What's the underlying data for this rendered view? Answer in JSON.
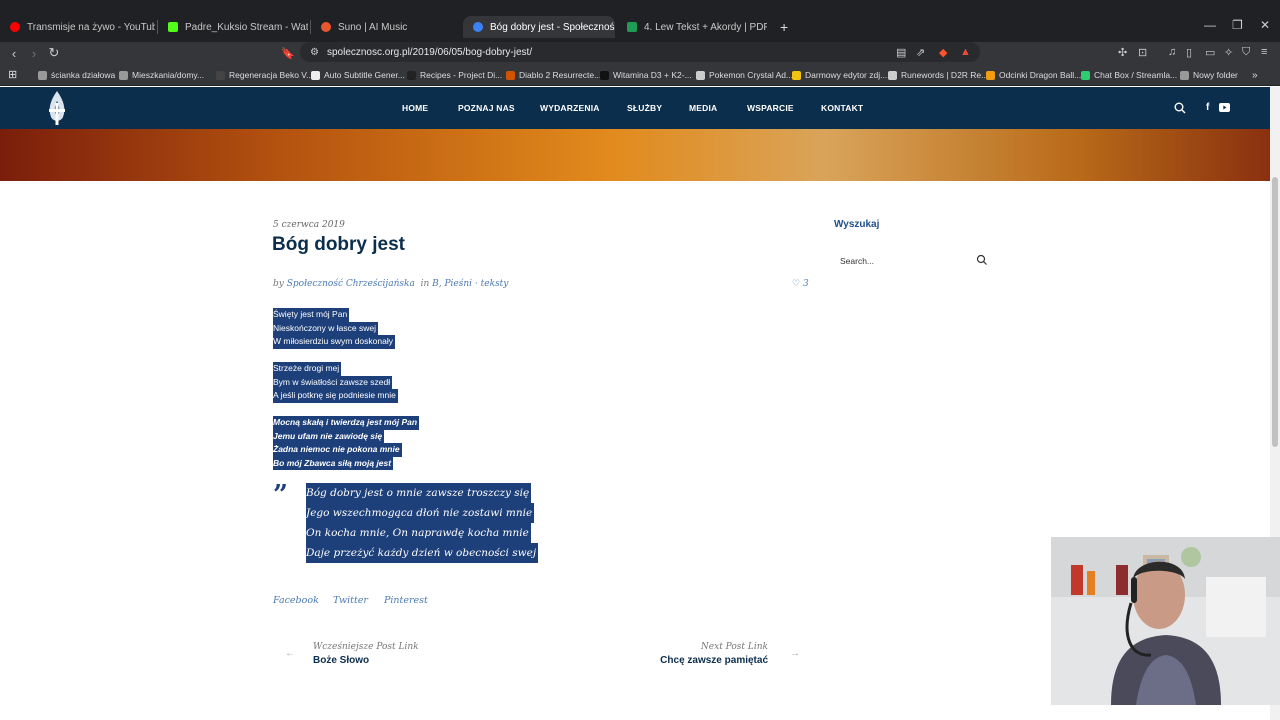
{
  "browser": {
    "tabs": [
      {
        "label": "Transmisje na żywo - YouTube Studio",
        "color": "#ff0000"
      },
      {
        "label": "Padre_Kuksio Stream - Watch Live on",
        "color": "#53fc18"
      },
      {
        "label": "Suno | AI Music",
        "color": "#e8572f"
      },
      {
        "label": "Bóg dobry jest - Społeczność Ch",
        "color": "#3b82f6",
        "active": true
      },
      {
        "label": "4. Lew Tekst + Akordy | PDF",
        "color": "#1f9d55"
      }
    ],
    "new_tab": "+",
    "url": "spolecznosc.org.pl/2019/06/05/bog-dobry-jest/",
    "bookmarks": [
      {
        "label": "ścianka działowa",
        "color": "#999"
      },
      {
        "label": "Mieszkania/domy...",
        "color": "#999"
      },
      {
        "label": "Regeneracja Beko V...",
        "color": "#444"
      },
      {
        "label": "Auto Subtitle Gener...",
        "color": "#eee"
      },
      {
        "label": "Recipes - Project Di...",
        "color": "#222"
      },
      {
        "label": "Diablo 2 Resurrecte...",
        "color": "#d35400"
      },
      {
        "label": "Witamina D3 + K2-...",
        "color": "#111"
      },
      {
        "label": "Pokemon Crystal Ad...",
        "color": "#ccc"
      },
      {
        "label": "Darmowy edytor zdj...",
        "color": "#f1c40f"
      },
      {
        "label": "Runewords | D2R Re...",
        "color": "#ccc"
      },
      {
        "label": "Odcinki Dragon Ball...",
        "color": "#f39c12"
      },
      {
        "label": "Chat Box / Streamla...",
        "color": "#2ecc71"
      },
      {
        "label": "Nowy folder",
        "color": "#999"
      }
    ]
  },
  "site": {
    "menu": [
      "HOME",
      "POZNAJ NAS",
      "WYDARZENIA",
      "SŁUŻBY",
      "MEDIA",
      "WSPARCIE",
      "KONTAKT"
    ],
    "colors": {
      "header": "#0c2e4d",
      "accent": "#1d4f8a",
      "selection": "#1d3f7a"
    }
  },
  "post": {
    "date": "5 czerwca 2019",
    "title": "Bóg dobry jest",
    "author_prefix": "by",
    "author": "Społeczność Chrześcijańska",
    "category_prefix": "in",
    "category_b": "B",
    "category_songs": "Pieśni",
    "category_sep": "·",
    "category_texts": "teksty",
    "likes": "3",
    "stanza1": [
      "Święty jest mój Pan",
      "Nieskończony w łasce swej",
      "W miłosierdziu swym doskonały"
    ],
    "stanza2": [
      "Strzeże drogi mej",
      "Bym w światłości zawsze szedł",
      "A jeśli potknę się podniesie mnie"
    ],
    "stanza3": [
      "Mocną skałą i twierdzą jest mój Pan",
      "Jemu ufam nie zawiodę się",
      "Żadna niemoc nie pokona mnie",
      "Bo mój Zbawca siłą moją jest"
    ],
    "quote_mark": "”",
    "quote": [
      "Bóg dobry jest o mnie zawsze troszczy się",
      "Jego wszechmogąca dłoń nie zostawi mnie",
      "On kocha mnie, On naprawdę kocha mnie",
      "Daje przeżyć każdy dzień w obecności swej"
    ],
    "share": [
      "Facebook",
      "Twitter",
      "Pinterest"
    ],
    "prev_label": "Wcześniejsze Post Link",
    "prev_title": "Boże Słowo",
    "next_label": "Next Post Link",
    "next_title": "Chcę zawsze pamiętać"
  },
  "sidebar": {
    "title": "Wyszukaj",
    "search_placeholder": "Search..."
  }
}
